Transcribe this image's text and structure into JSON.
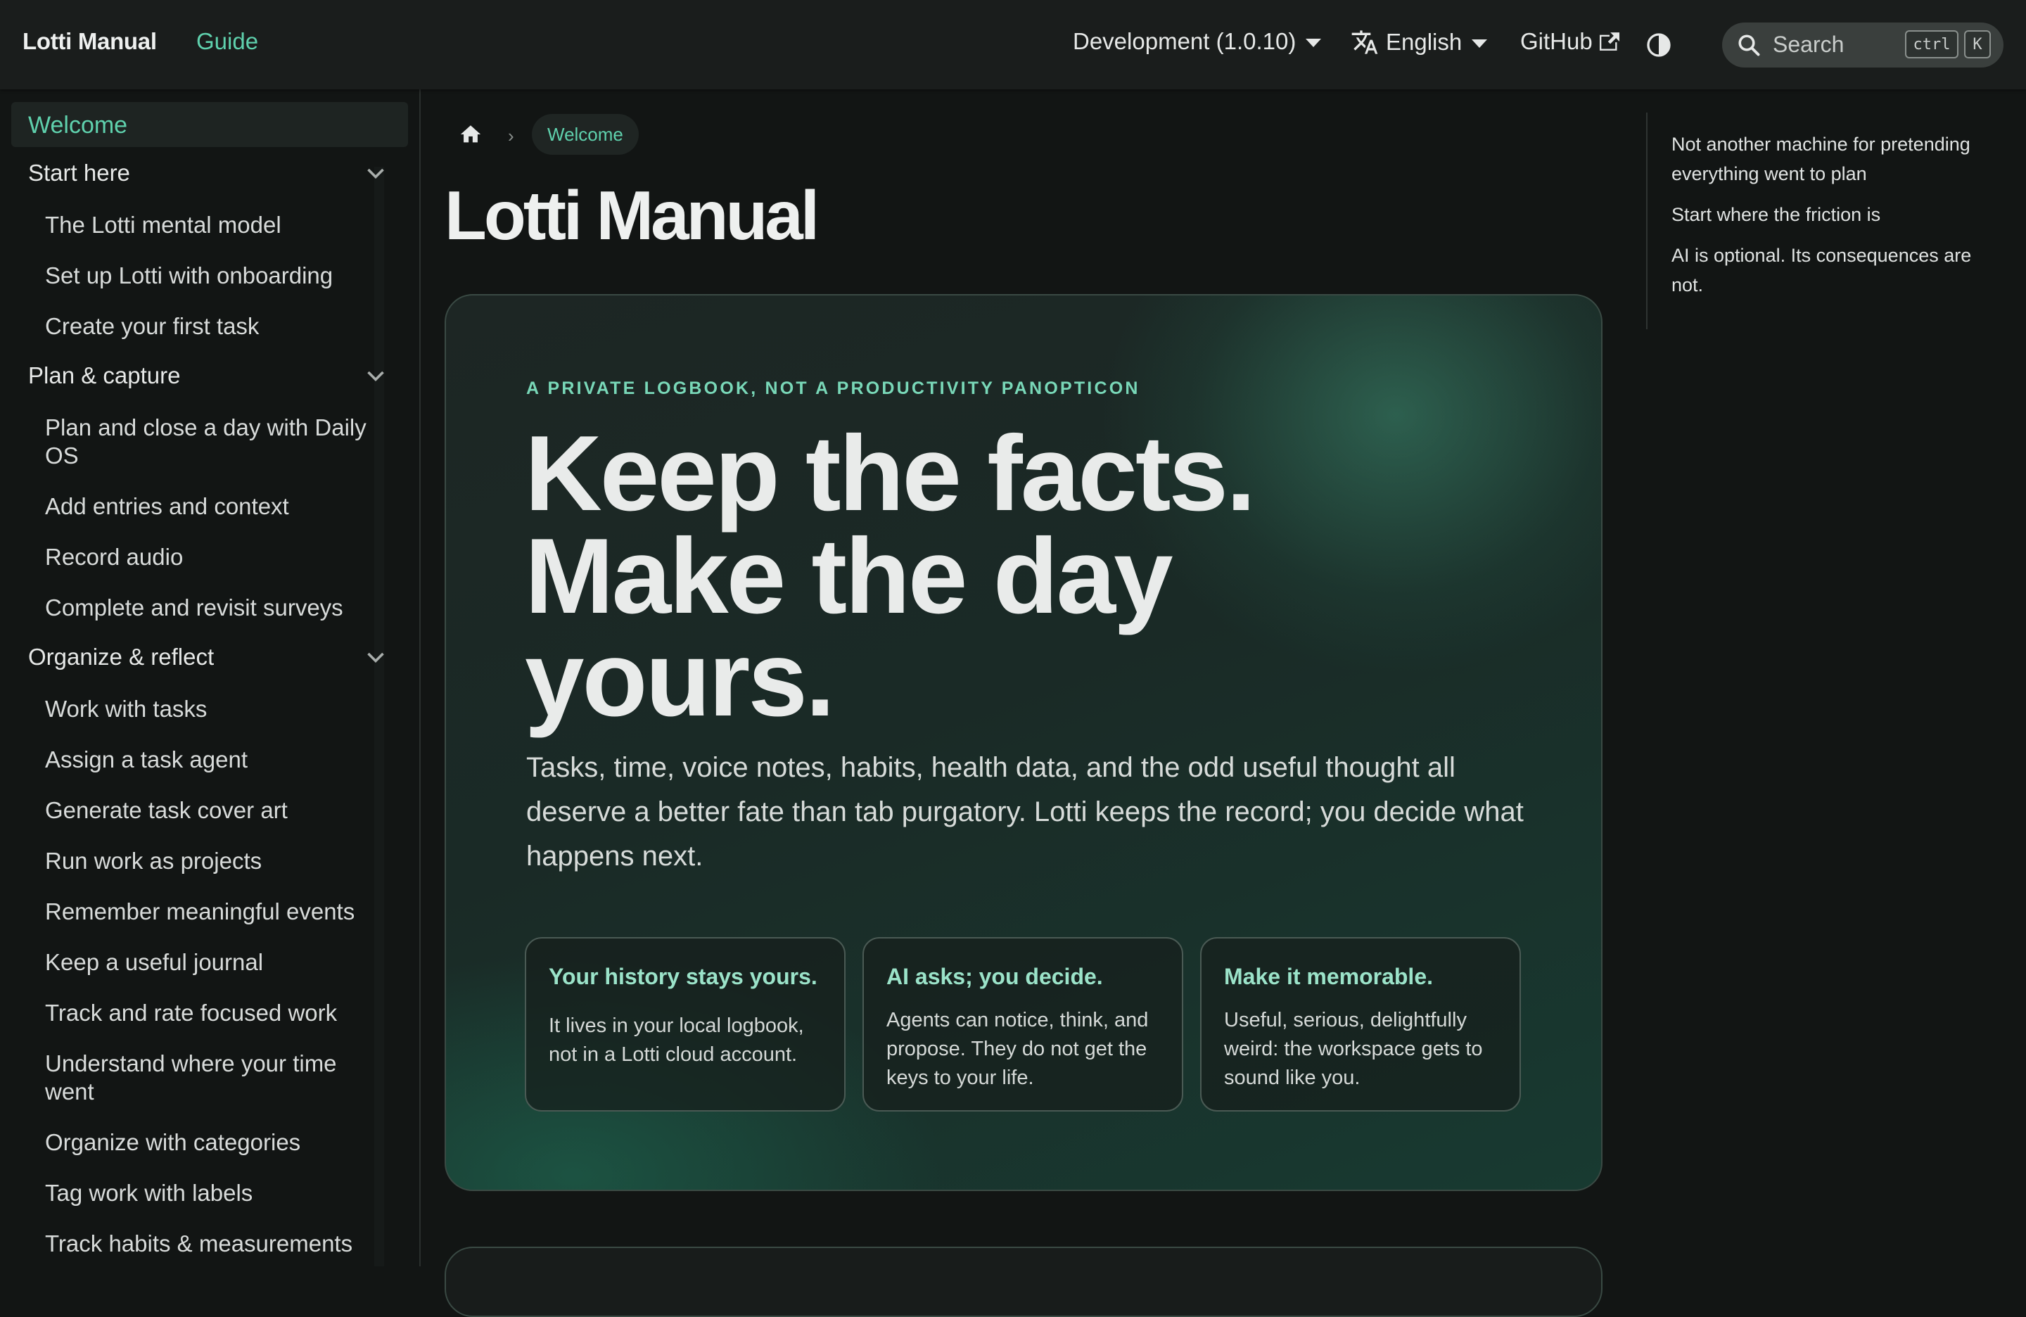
{
  "navbar": {
    "brand": "Lotti Manual",
    "guide": "Guide",
    "version": "Development (1.0.10)",
    "language": "English",
    "github": "GitHub",
    "search_placeholder": "Search",
    "kbd_ctrl": "ctrl",
    "kbd_k": "K"
  },
  "sidebar": {
    "welcome": "Welcome",
    "categories": [
      {
        "label": "Start here",
        "items": [
          "The Lotti mental model",
          "Set up Lotti with onboarding",
          "Create your first task"
        ]
      },
      {
        "label": "Plan & capture",
        "items": [
          "Plan and close a day with Daily OS",
          "Add entries and context",
          "Record audio",
          "Complete and revisit surveys"
        ]
      },
      {
        "label": "Organize & reflect",
        "items": [
          "Work with tasks",
          "Assign a task agent",
          "Generate task cover art",
          "Run work as projects",
          "Remember meaningful events",
          "Keep a useful journal",
          "Track and rate focused work",
          "Understand where your time went",
          "Organize with categories",
          "Tag work with labels",
          "Track habits & measurements"
        ]
      }
    ]
  },
  "breadcrumb": {
    "current": "Welcome"
  },
  "page_title": "Lotti Manual",
  "hero": {
    "eyebrow": "A PRIVATE LOGBOOK, NOT A PRODUCTIVITY PANOPTICON",
    "title_lines": [
      "Keep the facts.",
      "Make the day",
      "yours."
    ],
    "lead": "Tasks, time, voice notes, habits, health data, and the odd useful thought all deserve a better fate than tab purgatory. Lotti keeps the record; you decide what happens next.",
    "cards": [
      {
        "title": "Your history stays yours.",
        "body": "It lives in your local logbook, not in a Lotti cloud account."
      },
      {
        "title": "AI asks; you decide.",
        "body": "Agents can notice, think, and propose. They do not get the keys to your life."
      },
      {
        "title": "Make it memorable.",
        "body": "Useful, serious, delightfully weird: the workspace gets to sound like you."
      }
    ]
  },
  "toc": [
    "Not another machine for pretending everything went to plan",
    "Start where the friction is",
    "AI is optional. Its consequences are not."
  ],
  "colors": {
    "accent": "#5fd1ad",
    "background": "#121514",
    "navbar": "#1a1d1c"
  }
}
